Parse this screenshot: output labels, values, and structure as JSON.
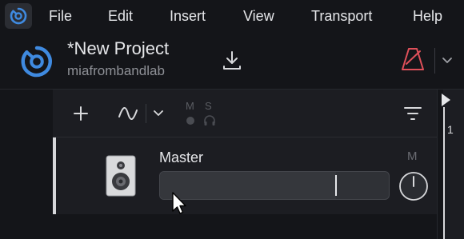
{
  "menu": {
    "items": [
      "File",
      "Edit",
      "Insert",
      "View",
      "Transport",
      "Help"
    ]
  },
  "project": {
    "title": "*New Project",
    "user": "miafrombandlab"
  },
  "toolbar": {
    "mute_label": "M",
    "solo_label": "S"
  },
  "track": {
    "name": "Master",
    "mute_label": "M",
    "volume": 0.77
  },
  "timeline": {
    "bar_number": "1"
  },
  "colors": {
    "accent_blue": "#3f8ae0",
    "metronome_red": "#e0505a",
    "background": "#141519",
    "panel": "#1c1d22"
  },
  "icons": {
    "app": "bandlab-logo-icon",
    "download": "download-icon",
    "metronome": "metronome-icon",
    "add": "plus-icon",
    "automation": "automation-wave-icon",
    "filter": "filter-icon",
    "instrument": "speaker-icon"
  }
}
